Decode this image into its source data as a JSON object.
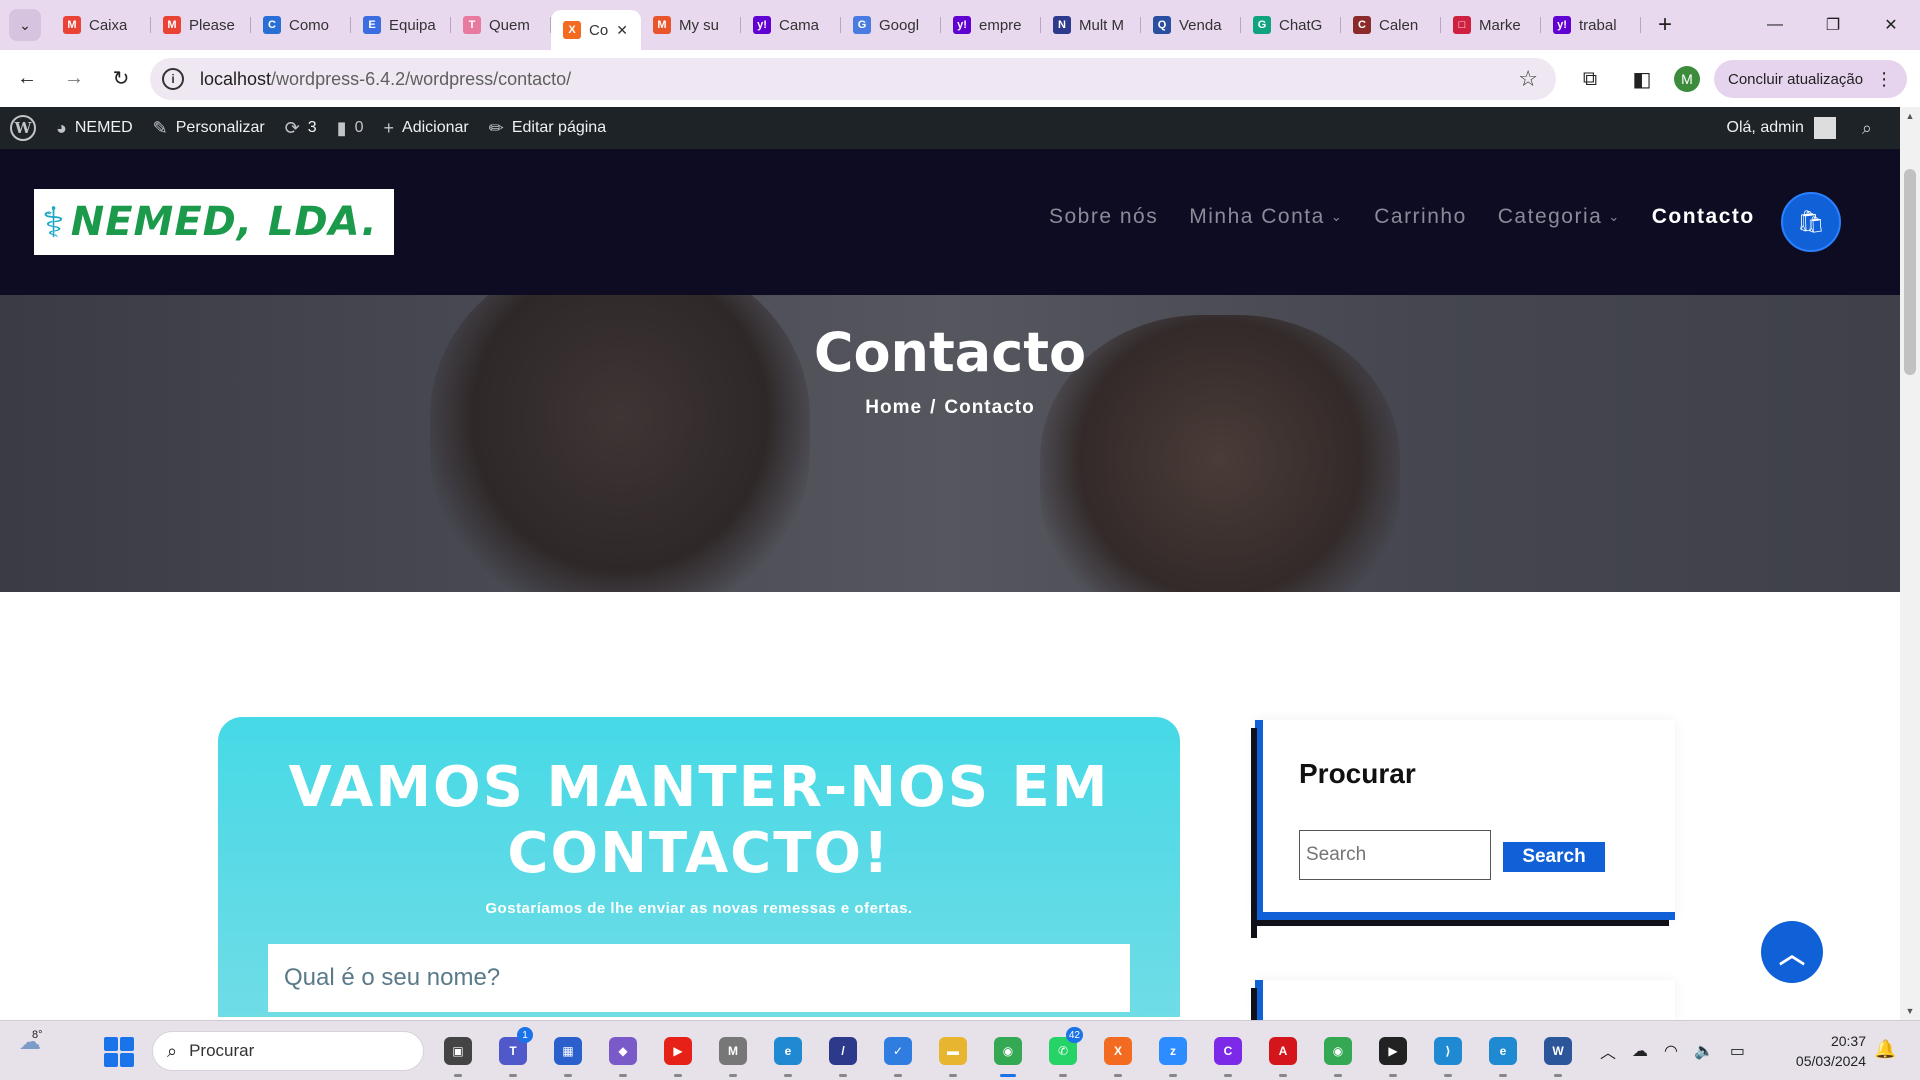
{
  "browser": {
    "tabs": [
      {
        "title": "Caixa",
        "favicon_color": "#ea4335",
        "favicon_glyph": "M"
      },
      {
        "title": "Please",
        "favicon_color": "#ea4335",
        "favicon_glyph": "M"
      },
      {
        "title": "Como",
        "favicon_color": "#2a6fd6",
        "favicon_glyph": "C"
      },
      {
        "title": "Equipa",
        "favicon_color": "#3b6de0",
        "favicon_glyph": "E"
      },
      {
        "title": "Quem",
        "favicon_color": "#e87aa0",
        "favicon_glyph": "T"
      },
      {
        "title": "Co",
        "favicon_color": "#f26b21",
        "favicon_glyph": "X",
        "active": true
      },
      {
        "title": "My su",
        "favicon_color": "#e8552a",
        "favicon_glyph": "M"
      },
      {
        "title": "Cama",
        "favicon_color": "#6001d2",
        "favicon_glyph": "y!"
      },
      {
        "title": "Googl",
        "favicon_color": "#4a7be0",
        "favicon_glyph": "G"
      },
      {
        "title": "empre",
        "favicon_color": "#6001d2",
        "favicon_glyph": "y!"
      },
      {
        "title": "Mult M",
        "favicon_color": "#2e3a8c",
        "favicon_glyph": "N"
      },
      {
        "title": "Venda",
        "favicon_color": "#2a4fa0",
        "favicon_glyph": "Q"
      },
      {
        "title": "ChatG",
        "favicon_color": "#10a37f",
        "favicon_glyph": "G"
      },
      {
        "title": "Calen",
        "favicon_color": "#8b2a2a",
        "favicon_glyph": "C"
      },
      {
        "title": "Marke",
        "favicon_color": "#d02040",
        "favicon_glyph": "□"
      },
      {
        "title": "trabal",
        "favicon_color": "#6001d2",
        "favicon_glyph": "y!"
      }
    ],
    "new_tab_glyph": "+",
    "url_host": "localhost",
    "url_path": "/wordpress-6.4.2/wordpress/contacto/",
    "profile_initial": "M",
    "update_button": "Concluir atualização"
  },
  "adminbar": {
    "site_name": "NEMED",
    "customize": "Personalizar",
    "updates_count": "3",
    "comments_count": "0",
    "add_new": "Adicionar",
    "edit_page": "Editar página",
    "greeting": "Olá, admin"
  },
  "site": {
    "logo_text": "NEMED, LDA.",
    "nav": [
      {
        "label": "Sobre nós",
        "has_dropdown": false
      },
      {
        "label": "Minha Conta",
        "has_dropdown": true
      },
      {
        "label": "Carrinho",
        "has_dropdown": false
      },
      {
        "label": "Categoria",
        "has_dropdown": true
      },
      {
        "label": "Contacto",
        "has_dropdown": false,
        "current": true
      }
    ],
    "accent_color": "#1060d8"
  },
  "hero": {
    "title": "Contacto",
    "breadcrumb_home": "Home",
    "breadcrumb_sep": "/",
    "breadcrumb_current": "Contacto"
  },
  "contact_card": {
    "heading_line1": "VAMOS MANTER-NOS EM",
    "heading_line2": "CONTACTO!",
    "subtitle": "Gostaríamos de lhe enviar as novas remessas e ofertas.",
    "name_placeholder": "Qual é o seu nome?"
  },
  "sidebar": {
    "search_widget_title": "Procurar",
    "search_placeholder": "Search",
    "search_button": "Search"
  },
  "taskbar": {
    "weather_temp": "8°",
    "search_label": "Procurar",
    "apps": [
      {
        "name": "file-explorer-alt",
        "color": "#444",
        "glyph": "▣"
      },
      {
        "name": "teams",
        "color": "#5059c9",
        "glyph": "T",
        "badge": "1"
      },
      {
        "name": "microsoft-store",
        "color": "#2b5fcb",
        "glyph": "▦"
      },
      {
        "name": "copilot",
        "color": "#7a5ac8",
        "glyph": "◆"
      },
      {
        "name": "youtube",
        "color": "#e62117",
        "glyph": "▶"
      },
      {
        "name": "m-app",
        "color": "#777",
        "glyph": "M"
      },
      {
        "name": "edge",
        "color": "#1f8ad2",
        "glyph": "e"
      },
      {
        "name": "vs-app",
        "color": "#2d3a8c",
        "glyph": "/"
      },
      {
        "name": "todo",
        "color": "#2f7de1",
        "glyph": "✓"
      },
      {
        "name": "folder",
        "color": "#e8b530",
        "glyph": "▬"
      },
      {
        "name": "chrome",
        "color": "#34a853",
        "glyph": "◉",
        "active": true
      },
      {
        "name": "whatsapp",
        "color": "#25d366",
        "glyph": "✆",
        "badge": "42"
      },
      {
        "name": "xampp",
        "color": "#f26b21",
        "glyph": "X"
      },
      {
        "name": "zoom",
        "color": "#2d8cff",
        "glyph": "z"
      },
      {
        "name": "canva",
        "color": "#7d2ae8",
        "glyph": "C"
      },
      {
        "name": "acrobat",
        "color": "#d4161c",
        "glyph": "A"
      },
      {
        "name": "chrome-profile",
        "color": "#34a853",
        "glyph": "◉"
      },
      {
        "name": "media-player",
        "color": "#222",
        "glyph": "▶"
      },
      {
        "name": "vscode",
        "color": "#1f8ad2",
        "glyph": "⟩"
      },
      {
        "name": "edge-dev",
        "color": "#1f8ad2",
        "glyph": "e"
      },
      {
        "name": "word",
        "color": "#2b579a",
        "glyph": "W"
      }
    ],
    "time": "20:37",
    "date": "05/03/2024"
  }
}
